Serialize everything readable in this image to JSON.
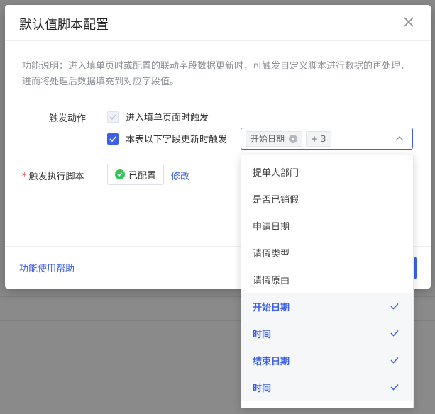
{
  "dialog": {
    "title": "默认值脚本配置",
    "description": "功能说明：进入填单页时或配置的联动字段数据更新时，可触发自定义脚本进行数据的再处理，进而将处理后数据填充到对应字段值。"
  },
  "trigger": {
    "label": "触发动作",
    "option_enter": "进入填单页面时触发",
    "option_field_update": "本表以下字段更新时触发",
    "selected_tag": "开始日期",
    "more_count": "+ 3"
  },
  "script": {
    "label": "触发执行脚本",
    "status": "已配置",
    "edit_link": "修改"
  },
  "footer": {
    "help_link": "功能使用帮助"
  },
  "dropdown": {
    "items": [
      {
        "label": "提单人部门",
        "selected": false
      },
      {
        "label": "是否已销假",
        "selected": false
      },
      {
        "label": "申请日期",
        "selected": false
      },
      {
        "label": "请假类型",
        "selected": false
      },
      {
        "label": "请假原由",
        "selected": false
      },
      {
        "label": "开始日期",
        "selected": true
      },
      {
        "label": "时间",
        "selected": true
      },
      {
        "label": "结束日期",
        "selected": true
      },
      {
        "label": "时间",
        "selected": true
      }
    ]
  },
  "colors": {
    "accent": "#3c60e6",
    "success": "#35c45b",
    "required": "#e5484d"
  }
}
